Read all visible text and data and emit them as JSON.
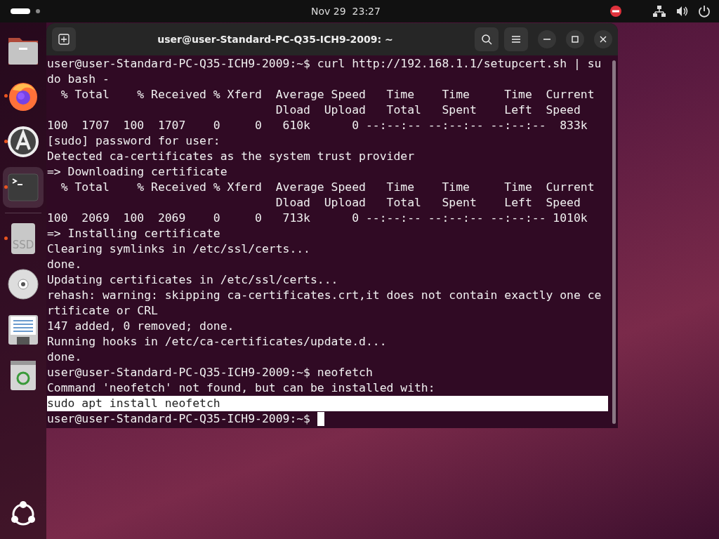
{
  "top_bar": {
    "clock": "Nov 29  23:27"
  },
  "dock": {
    "items": [
      {
        "kind": "files",
        "running": false,
        "active": false
      },
      {
        "kind": "firefox",
        "running": true,
        "active": false
      },
      {
        "kind": "software",
        "running": true,
        "active": false
      },
      {
        "kind": "terminal",
        "running": true,
        "active": true
      },
      {
        "kind": "disk",
        "running": true,
        "active": false,
        "label": "SSD"
      },
      {
        "kind": "disc",
        "running": false,
        "active": false
      },
      {
        "kind": "editor",
        "running": false,
        "active": false
      },
      {
        "kind": "trash",
        "running": false,
        "active": false
      }
    ]
  },
  "window": {
    "title": "user@user-Standard-PC-Q35-ICH9-2009: ~"
  },
  "terminal": {
    "lines": [
      {
        "text": "user@user-Standard-PC-Q35-ICH9-2009:~$ curl http://192.168.1.1/setupcert.sh | su",
        "selected": false
      },
      {
        "text": "do bash -",
        "selected": false
      },
      {
        "text": "  % Total    % Received % Xferd  Average Speed   Time    Time     Time  Current",
        "selected": false
      },
      {
        "text": "                                 Dload  Upload   Total   Spent    Left  Speed",
        "selected": false
      },
      {
        "text": "100  1707  100  1707    0     0   610k      0 --:--:-- --:--:-- --:--:--  833k",
        "selected": false
      },
      {
        "text": "[sudo] password for user:",
        "selected": false
      },
      {
        "text": "Detected ca-certificates as the system trust provider",
        "selected": false
      },
      {
        "text": "=> Downloading certificate",
        "selected": false
      },
      {
        "text": "  % Total    % Received % Xferd  Average Speed   Time    Time     Time  Current",
        "selected": false
      },
      {
        "text": "                                 Dload  Upload   Total   Spent    Left  Speed",
        "selected": false
      },
      {
        "text": "100  2069  100  2069    0     0   713k      0 --:--:-- --:--:-- --:--:-- 1010k",
        "selected": false
      },
      {
        "text": "=> Installing certificate",
        "selected": false
      },
      {
        "text": "Clearing symlinks in /etc/ssl/certs...",
        "selected": false
      },
      {
        "text": "done.",
        "selected": false
      },
      {
        "text": "Updating certificates in /etc/ssl/certs...",
        "selected": false
      },
      {
        "text": "rehash: warning: skipping ca-certificates.crt,it does not contain exactly one ce",
        "selected": false
      },
      {
        "text": "rtificate or CRL",
        "selected": false
      },
      {
        "text": "147 added, 0 removed; done.",
        "selected": false
      },
      {
        "text": "Running hooks in /etc/ca-certificates/update.d...",
        "selected": false
      },
      {
        "text": "done.",
        "selected": false
      },
      {
        "text": "user@user-Standard-PC-Q35-ICH9-2009:~$ neofetch",
        "selected": false
      },
      {
        "text": "Command 'neofetch' not found, but can be installed with:",
        "selected": false
      },
      {
        "text": "sudo apt install neofetch",
        "selected": true
      }
    ],
    "prompt": "user@user-Standard-PC-Q35-ICH9-2009:~$"
  }
}
